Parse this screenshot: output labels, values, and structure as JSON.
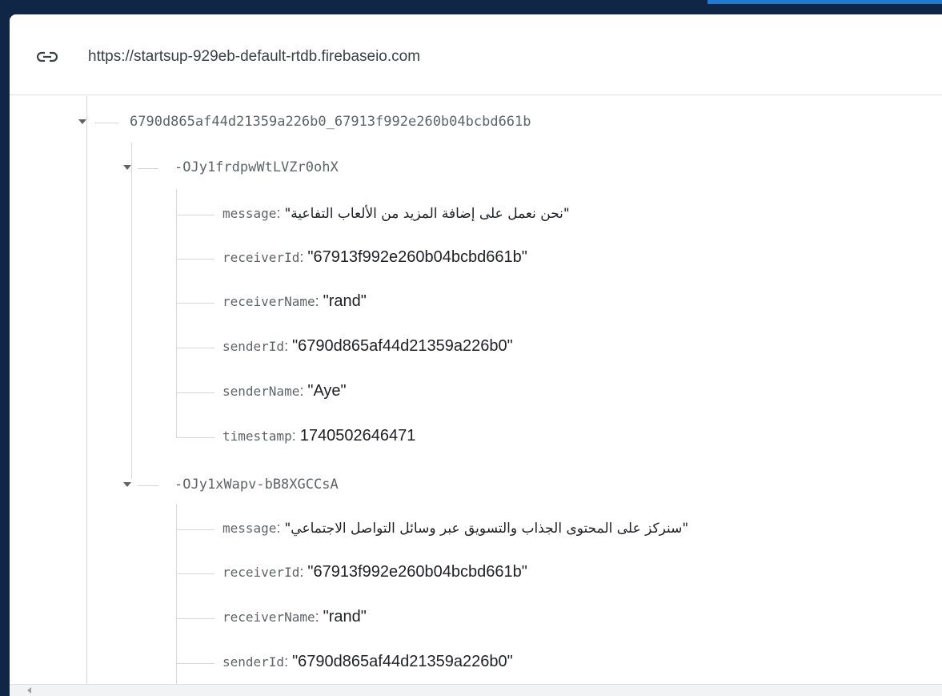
{
  "database": {
    "url": "https://startsup-929eb-default-rtdb.firebaseio.com"
  },
  "icons": {
    "link": "link-icon",
    "expand": "caret-down-icon",
    "scroll_left": "scroll-left-arrow-icon"
  },
  "colors": {
    "outer_background": "#0f2647",
    "accent": "#1f7ad1",
    "key_text": "#5f6368",
    "value_text": "#202124"
  },
  "tree": {
    "root_key": "6790d865af44d21359a226b0_67913f992e260b04bcbd661b",
    "children": [
      {
        "key": "-OJy1frdpwWtLVZr0ohX",
        "fields": [
          {
            "name": "message",
            "value": "\"نحن نعمل على إضافة المزيد من الألعاب التفاعية\""
          },
          {
            "name": "receiverId",
            "value": "\"67913f992e260b04bcbd661b\""
          },
          {
            "name": "receiverName",
            "value": "\"rand\""
          },
          {
            "name": "senderId",
            "value": "\"6790d865af44d21359a226b0\""
          },
          {
            "name": "senderName",
            "value": "\"Aye\""
          },
          {
            "name": "timestamp",
            "value": "1740502646471"
          }
        ]
      },
      {
        "key": "-OJy1xWapv-bB8XGCCsA",
        "fields": [
          {
            "name": "message",
            "value": "\"سنركز على المحتوى الجذاب والتسويق عبر وسائل التواصل الاجتماعي\""
          },
          {
            "name": "receiverId",
            "value": "\"67913f992e260b04bcbd661b\""
          },
          {
            "name": "receiverName",
            "value": "\"rand\""
          },
          {
            "name": "senderId",
            "value": "\"6790d865af44d21359a226b0\""
          }
        ]
      }
    ]
  }
}
